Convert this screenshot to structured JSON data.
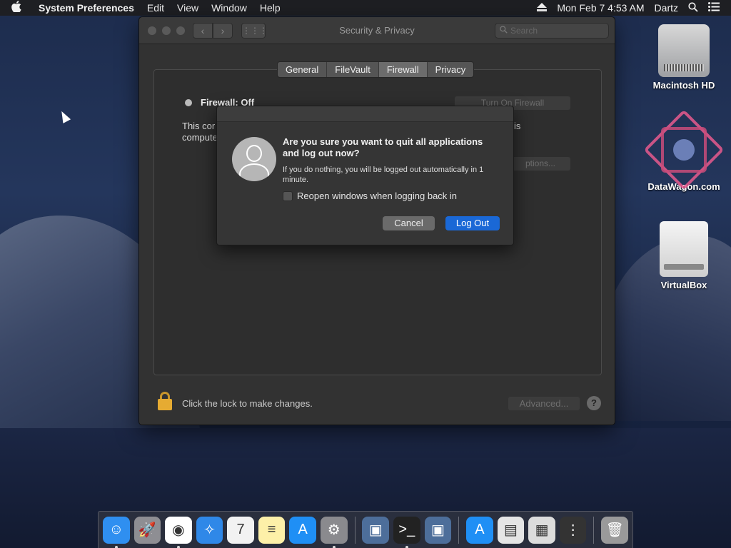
{
  "menubar": {
    "apple": "",
    "app_name": "System Preferences",
    "items": [
      "Edit",
      "View",
      "Window",
      "Help"
    ],
    "clock": "Mon Feb 7  4:53 AM",
    "user": "Dartz"
  },
  "window": {
    "title": "Security & Privacy",
    "search_placeholder": "Search",
    "tabs": [
      "General",
      "FileVault",
      "Firewall",
      "Privacy"
    ],
    "active_tab": "Firewall",
    "firewall_status": "Firewall: Off",
    "turn_on_button": "Turn On Firewall",
    "description_left": "This cor\ncompute",
    "description_right": "is",
    "options_button": "ptions...",
    "lock_text": "Click the lock to make changes.",
    "advanced_button": "Advanced...",
    "help": "?"
  },
  "dialog": {
    "title": "Are you sure you want to quit all applications and log out now?",
    "subtitle": "If you do nothing, you will be logged out automatically in 1 minute.",
    "checkbox_label": "Reopen windows when logging back in",
    "checkbox_checked": false,
    "cancel": "Cancel",
    "confirm": "Log Out"
  },
  "desktop": {
    "icons": [
      {
        "label": "Macintosh HD"
      },
      {
        "label": "DataWagon.com"
      },
      {
        "label": "VirtualBox"
      }
    ]
  },
  "dock": {
    "items": [
      {
        "name": "finder",
        "glyph": "☺",
        "bg": "#2f8ff0",
        "running": true
      },
      {
        "name": "launchpad",
        "glyph": "🚀",
        "bg": "#8e8e93",
        "running": false
      },
      {
        "name": "chrome",
        "glyph": "◉",
        "bg": "#ffffff",
        "running": true
      },
      {
        "name": "safari",
        "glyph": "✧",
        "bg": "#2f88e8",
        "running": false
      },
      {
        "name": "calendar",
        "glyph": "7",
        "bg": "#f2f2f2",
        "running": false
      },
      {
        "name": "notes",
        "glyph": "≡",
        "bg": "#fdf0a8",
        "running": false
      },
      {
        "name": "app-store",
        "glyph": "A",
        "bg": "#1f8ff5",
        "running": false
      },
      {
        "name": "system-preferences",
        "glyph": "⚙",
        "bg": "#8a8a8e",
        "running": true
      },
      {
        "name": "virtualbox",
        "glyph": "▣",
        "bg": "#4d6e9a",
        "running": false
      },
      {
        "name": "terminal",
        "glyph": ">_",
        "bg": "#222222",
        "running": true
      },
      {
        "name": "virtualbox-manager",
        "glyph": "▣",
        "bg": "#4d6e9a",
        "running": false
      },
      {
        "name": "app-store-download",
        "glyph": "A",
        "bg": "#1f8ff5",
        "running": false
      },
      {
        "name": "document",
        "glyph": "▤",
        "bg": "#e5e5e5",
        "running": false
      },
      {
        "name": "screenshot",
        "glyph": "▦",
        "bg": "#dcdcdc",
        "running": false
      },
      {
        "name": "downloads",
        "glyph": "⋮",
        "bg": "#333333",
        "running": false
      },
      {
        "name": "trash",
        "glyph": "🗑",
        "bg": "#9a9a9a",
        "running": false
      }
    ]
  }
}
